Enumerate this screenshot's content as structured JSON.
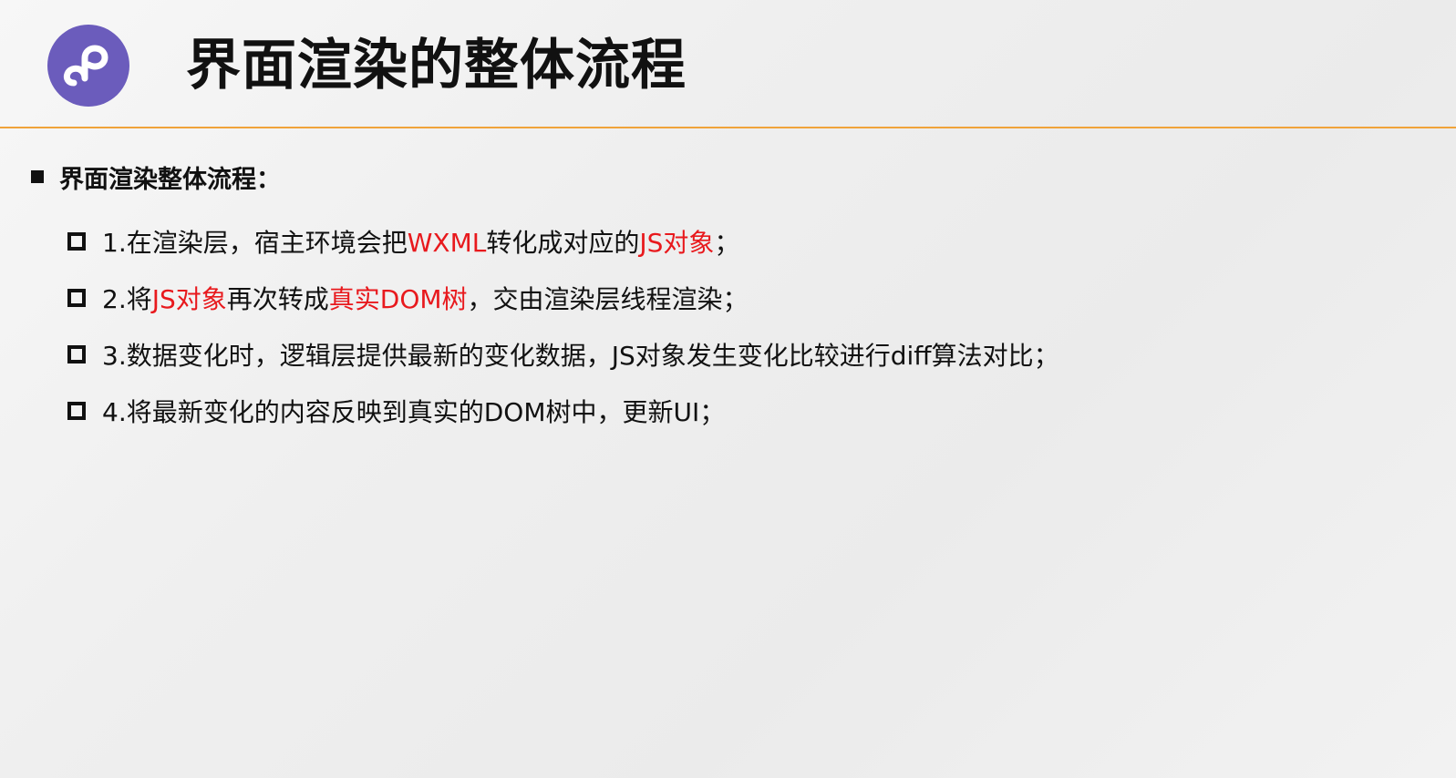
{
  "header": {
    "logo_icon": "mini-program-logo-icon",
    "title": "界面渲染的整体流程",
    "rule_color": "#f0a33a",
    "logo_color": "#6b5cbc"
  },
  "section": {
    "heading": "界面渲染整体流程：",
    "items": [
      {
        "segments": [
          {
            "text": "1.在渲染层，宿主环境会把",
            "highlight": false
          },
          {
            "text": "WXML",
            "highlight": true
          },
          {
            "text": "转化成对应的",
            "highlight": false
          },
          {
            "text": "JS对象",
            "highlight": true
          },
          {
            "text": "；",
            "highlight": false
          }
        ]
      },
      {
        "segments": [
          {
            "text": "2.将",
            "highlight": false
          },
          {
            "text": "JS对象",
            "highlight": true
          },
          {
            "text": "再次转成",
            "highlight": false
          },
          {
            "text": "真实DOM树",
            "highlight": true
          },
          {
            "text": "，交由渲染层线程渲染；",
            "highlight": false
          }
        ]
      },
      {
        "segments": [
          {
            "text": "3.数据变化时，逻辑层提供最新的变化数据，JS对象发生变化比较进行diff算法对比；",
            "highlight": false
          }
        ]
      },
      {
        "segments": [
          {
            "text": "4.将最新变化的内容反映到真实的DOM树中，更新UI；",
            "highlight": false
          }
        ]
      }
    ],
    "highlight_color": "#e8191d"
  }
}
